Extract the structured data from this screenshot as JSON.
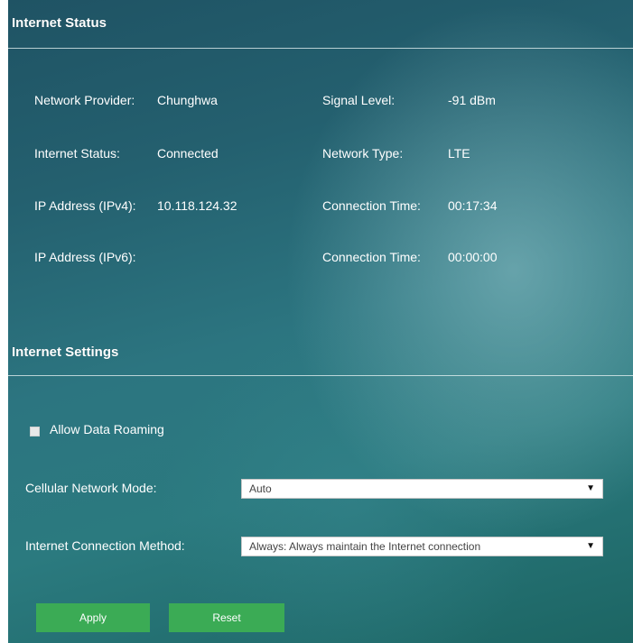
{
  "internet_status": {
    "title": "Internet Status",
    "network_provider": {
      "label": "Network Provider:",
      "value": "Chunghwa"
    },
    "internet_status": {
      "label": "Internet Status:",
      "value": "Connected"
    },
    "ipv4": {
      "label": "IP Address (IPv4):",
      "value": "10.118.124.32"
    },
    "ipv6": {
      "label": "IP Address (IPv6):",
      "value": ""
    },
    "signal_level": {
      "label": "Signal Level:",
      "value": "-91 dBm"
    },
    "network_type": {
      "label": "Network Type:",
      "value": "LTE"
    },
    "connection_time_1": {
      "label": "Connection Time:",
      "value": "00:17:34"
    },
    "connection_time_2": {
      "label": "Connection Time:",
      "value": "00:00:00"
    }
  },
  "internet_settings": {
    "title": "Internet Settings",
    "allow_roaming": {
      "label": "Allow Data Roaming",
      "checked": false
    },
    "cellular_mode": {
      "label": "Cellular Network Mode:",
      "value": "Auto"
    },
    "connection_method": {
      "label": "Internet Connection Method:",
      "value": "Always: Always maintain the Internet connection"
    }
  },
  "buttons": {
    "apply": "Apply",
    "reset": "Reset"
  },
  "icons": {
    "dropdown": "chevron-down-icon"
  },
  "colors": {
    "button": "#3bab55",
    "panel": "#2a6f7b"
  }
}
